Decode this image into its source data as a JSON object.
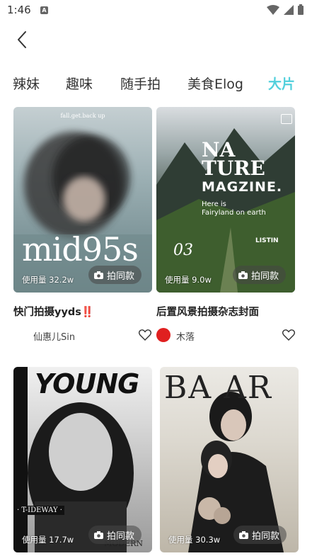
{
  "status": {
    "time": "1:46",
    "a_badge": "A"
  },
  "tabs": [
    {
      "label": "辣妹"
    },
    {
      "label": "趣味"
    },
    {
      "label": "随手拍"
    },
    {
      "label": "美食Elog"
    },
    {
      "label": "大片",
      "active": true
    }
  ],
  "cards": [
    {
      "image_text": {
        "top": "fall.get.back up",
        "big": "mid95s"
      },
      "usage": "使用量 32.2w",
      "button": "拍同款",
      "title": "快门拍摄yyds‼️",
      "author": "仙惠儿Sin"
    },
    {
      "image_text": {
        "big1": "NA",
        "big2": "TURE",
        "big3": "MAGZINE.",
        "line1": "Here is",
        "line2": "Fairyland on earth",
        "num": "03",
        "side": "LISTIN"
      },
      "usage": "使用量 9.0w",
      "button": "拍同款",
      "title": "后置风景拍摄杂志封面",
      "author": "木落"
    },
    {
      "image_text": {
        "big": "YOUNG",
        "tag": "· T-IDEWAY ·",
        "bottom": "MODERN"
      },
      "usage": "使用量 17.7w",
      "button": "拍同款"
    },
    {
      "image_text": {
        "big": "BA  AR"
      },
      "usage": "使用量 30.3w",
      "button": "拍同款"
    }
  ],
  "colors": {
    "accent": "#52d0dc",
    "button_bg": "rgba(70,70,70,0.55)"
  }
}
